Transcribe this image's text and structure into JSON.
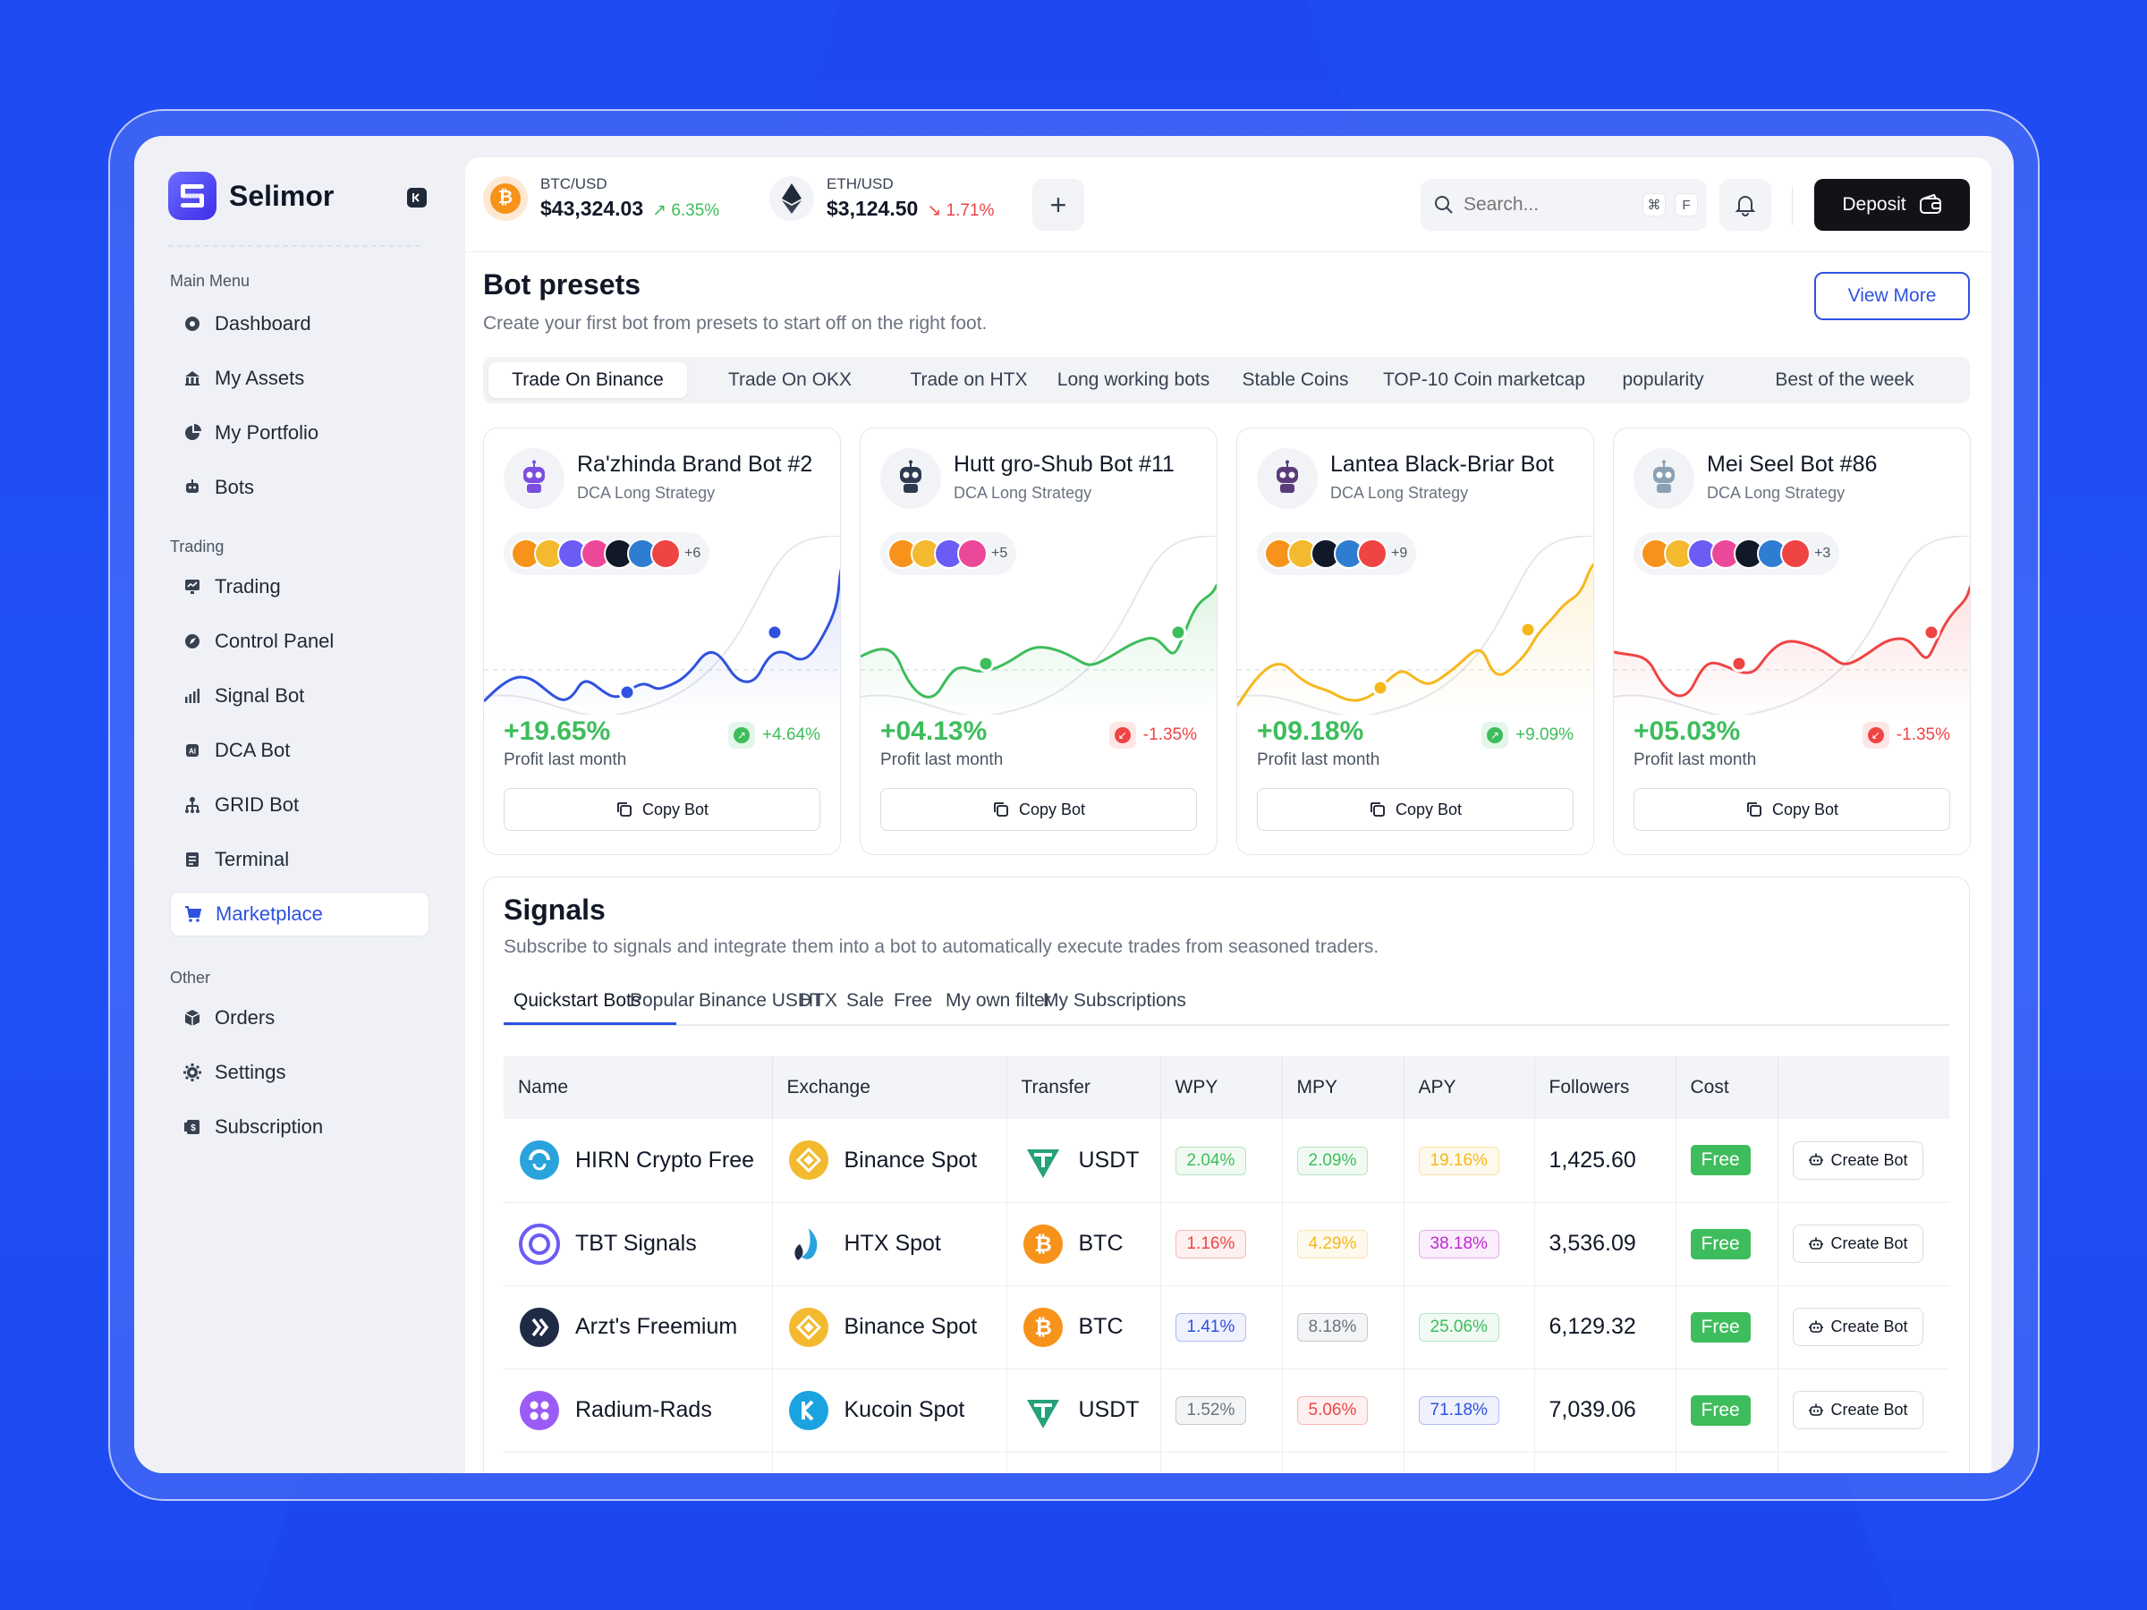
{
  "app": {
    "name": "Selimor"
  },
  "sidebar": {
    "groups": [
      {
        "label": "Main Menu"
      },
      {
        "label": "Trading"
      },
      {
        "label": "Other"
      }
    ],
    "items": [
      {
        "label": "Dashboard",
        "icon": "dashboard-icon"
      },
      {
        "label": "My Assets",
        "icon": "bank-icon"
      },
      {
        "label": "My Portfolio",
        "icon": "pie-chart-icon"
      },
      {
        "label": "Bots",
        "icon": "robot-icon"
      },
      {
        "label": "Trading",
        "icon": "trading-icon"
      },
      {
        "label": "Control Panel",
        "icon": "compass-icon"
      },
      {
        "label": "Signal Bot",
        "icon": "signal-bars-icon"
      },
      {
        "label": "DCA Bot",
        "icon": "ai-chip-icon"
      },
      {
        "label": "GRID Bot",
        "icon": "grid-network-icon"
      },
      {
        "label": "Terminal",
        "icon": "terminal-icon"
      },
      {
        "label": "Marketplace",
        "icon": "cart-icon",
        "active": true
      },
      {
        "label": "Orders",
        "icon": "box-icon"
      },
      {
        "label": "Settings",
        "icon": "gear-icon"
      },
      {
        "label": "Subscription",
        "icon": "dollar-card-icon"
      }
    ]
  },
  "topbar": {
    "tickers": [
      {
        "pair": "BTC/USD",
        "price": "$43,324.03",
        "change": "6.35%",
        "direction": "up",
        "color": "#3dbd5c"
      },
      {
        "pair": "ETH/USD",
        "price": "$3,124.50",
        "change": "1.71%",
        "direction": "down",
        "color": "#ef4444"
      }
    ],
    "add_label": "+",
    "search_placeholder": "Search...",
    "shortcut_keys": [
      "⌘",
      "F"
    ],
    "deposit_label": "Deposit"
  },
  "presets": {
    "title": "Bot presets",
    "subtitle": "Create your first bot from presets to start off on the right foot.",
    "view_more": "View More",
    "tabs": [
      "Trade On Binance",
      "Trade On OKX",
      "Trade on HTX",
      "Long working bots",
      "Stable Coins",
      "TOP-10 Coin marketcap",
      "popularity",
      "Best of the week"
    ],
    "active_tab": 0,
    "copy_label": "Copy Bot",
    "profit_label": "Profit last month",
    "cards": [
      {
        "name": "Ra'zhinda Brand Bot #2",
        "strategy": "DCA Long Strategy",
        "more": "+6",
        "profit": "+19.65%",
        "delta": "+4.64%",
        "delta_dir": "up",
        "color": "#2f52e0",
        "coins": [
          "#f7931a",
          "#f3ba2f",
          "#6b5cf6",
          "#ec4899",
          "#111827",
          "#2f7dd1",
          "#ef4444"
        ]
      },
      {
        "name": "Hutt gro-Shub Bot #11",
        "strategy": "DCA Long Strategy",
        "more": "+5",
        "profit": "+04.13%",
        "delta": "-1.35%",
        "delta_dir": "down",
        "color": "#3dbd5c",
        "coins": [
          "#f7931a",
          "#f3ba2f",
          "#6b5cf6",
          "#ec4899"
        ]
      },
      {
        "name": "Lantea Black-Briar Bot",
        "strategy": "DCA Long Strategy",
        "more": "+9",
        "profit": "+09.18%",
        "delta": "+9.09%",
        "delta_dir": "up",
        "color": "#f5b81c",
        "coins": [
          "#f7931a",
          "#f3ba2f",
          "#111827",
          "#2f7dd1",
          "#ef4444"
        ]
      },
      {
        "name": "Mei Seel Bot #86",
        "strategy": "DCA Long Strategy",
        "more": "+3",
        "profit": "+05.03%",
        "delta": "-1.35%",
        "delta_dir": "down",
        "color": "#ef4444",
        "coins": [
          "#f7931a",
          "#f3ba2f",
          "#6b5cf6",
          "#ec4899",
          "#111827",
          "#2f7dd1",
          "#ef4444"
        ]
      }
    ]
  },
  "signals": {
    "title": "Signals",
    "subtitle": "Subscribe to signals and integrate them into a bot to automatically execute trades from seasoned traders.",
    "tabs": [
      "Quickstart Bots",
      "Popular",
      "Binance USDT",
      "HTX",
      "Sale",
      "Free",
      "My own filter",
      "My Subscriptions"
    ],
    "active_tab": 0,
    "columns": [
      "Name",
      "Exchange",
      "Transfer",
      "WPY",
      "MPY",
      "APY",
      "Followers",
      "Cost",
      ""
    ],
    "create_label": "Create Bot",
    "rows": [
      {
        "name": "HIRN Crypto Free",
        "name_icon": "hirn-logo-icon",
        "name_color": "#2aa3dc",
        "exchange": "Binance Spot",
        "ex_icon": "binance-icon",
        "ex_color": "#f3ba2f",
        "transfer": "USDT",
        "tr_icon": "tether-icon",
        "tr_color": "#26a17b",
        "wpy": "2.04%",
        "wpy_c": "#3dbd5c",
        "mpy": "2.09%",
        "mpy_c": "#3dbd5c",
        "apy": "19.16%",
        "apy_c": "#f5b81c",
        "followers": "1,425.60",
        "cost": "Free"
      },
      {
        "name": "TBT Signals",
        "name_icon": "tbt-logo-icon",
        "name_color": "#6b5cf6",
        "exchange": "HTX Spot",
        "ex_icon": "htx-icon",
        "ex_color": "#2aa3dc",
        "transfer": "BTC",
        "tr_icon": "bitcoin-icon",
        "tr_color": "#f7931a",
        "wpy": "1.16%",
        "wpy_c": "#ef4444",
        "mpy": "4.29%",
        "mpy_c": "#f5b81c",
        "apy": "38.18%",
        "apy_c": "#c026d3",
        "followers": "3,536.09",
        "cost": "Free"
      },
      {
        "name": "Arzt's Freemium",
        "name_icon": "arzt-logo-icon",
        "name_color": "#1f2a44",
        "exchange": "Binance Spot",
        "ex_icon": "binance-icon",
        "ex_color": "#f3ba2f",
        "transfer": "BTC",
        "tr_icon": "bitcoin-icon",
        "tr_color": "#f7931a",
        "wpy": "1.41%",
        "wpy_c": "#2f52e0",
        "mpy": "8.18%",
        "mpy_c": "#6b7280",
        "apy": "25.06%",
        "apy_c": "#3dbd5c",
        "followers": "6,129.32",
        "cost": "Free"
      },
      {
        "name": "Radium-Rads",
        "name_icon": "radium-logo-icon",
        "name_color": "#9b5cf6",
        "exchange": "Kucoin Spot",
        "ex_icon": "kucoin-icon",
        "ex_color": "#1aa3e0",
        "transfer": "USDT",
        "tr_icon": "tether-icon",
        "tr_color": "#26a17b",
        "wpy": "1.52%",
        "wpy_c": "#6b7280",
        "mpy": "5.06%",
        "mpy_c": "#ef4444",
        "apy": "71.18%",
        "apy_c": "#2f52e0",
        "followers": "7,039.06",
        "cost": "Free"
      }
    ]
  }
}
